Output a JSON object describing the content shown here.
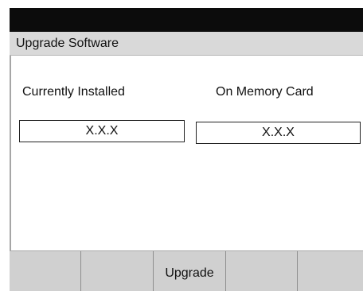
{
  "window": {
    "title": "Upgrade Software"
  },
  "versions": {
    "installed_label": "Currently Installed",
    "installed_value": "X.X.X",
    "card_label": "On Memory Card",
    "card_value": "X.X.X"
  },
  "softkeys": [
    {
      "label": ""
    },
    {
      "label": ""
    },
    {
      "label": "Upgrade"
    },
    {
      "label": ""
    },
    {
      "label": ""
    }
  ]
}
